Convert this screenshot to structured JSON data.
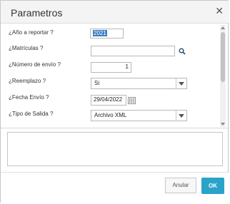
{
  "dialog": {
    "title": "Parametros",
    "close_icon": "close-icon"
  },
  "fields": [
    {
      "label": "¿Año a reportar ?",
      "value": "2021"
    },
    {
      "label": "¿Matrículas ?",
      "value": ""
    },
    {
      "label": "¿Número de envío ?",
      "value": "1"
    },
    {
      "label": "¿Reemplazo ?",
      "value": "Si"
    },
    {
      "label": "¿Fecha Envío ?",
      "value": "29/04/2022"
    },
    {
      "label": "¿Tipo de Salida ?",
      "value": "Archivo XML"
    }
  ],
  "icons": {
    "search": "search-icon",
    "calendar": "calendar-icon"
  },
  "footer": {
    "cancel_label": "Anular",
    "ok_label": "OK"
  },
  "colors": {
    "primary_button": "#2aa3c9",
    "selection": "#3b7fc4"
  }
}
